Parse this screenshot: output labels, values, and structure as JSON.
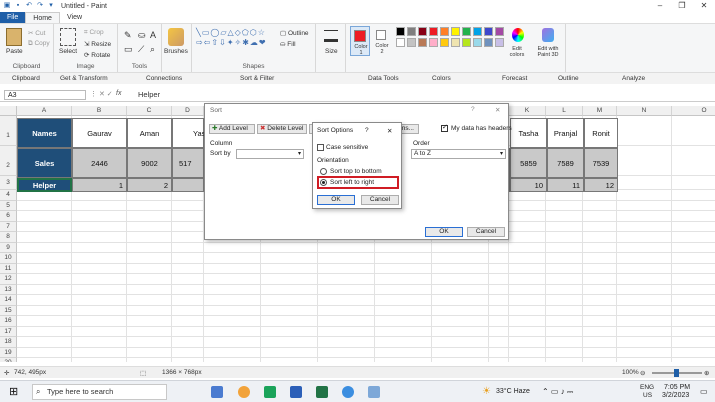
{
  "window": {
    "title": "Untitled - Paint"
  },
  "tabs": [
    "File",
    "Home",
    "View"
  ],
  "ribbon": {
    "clipboard": {
      "paste": "Paste",
      "cut": "Cut",
      "copy": "Copy",
      "label": "Clipboard"
    },
    "image": {
      "crop": "Crop",
      "resize": "Resize",
      "rotate": "Rotate",
      "select": "Select",
      "label": "Image"
    },
    "tools": {
      "label": "Tools"
    },
    "brushes": {
      "label": "Brushes"
    },
    "shapes": {
      "outline": "Outline",
      "fill": "Fill",
      "label": "Shapes"
    },
    "size": {
      "label": "Size"
    },
    "colors": {
      "color1": "Color 1",
      "color2": "Color 2",
      "edit": "Edit colors",
      "paint3d": "Edit with Paint 3D",
      "label": "Colors"
    },
    "excel_groups": [
      "Get & Transform",
      "Connections",
      "Sort & Filter",
      "Data Tools",
      "Forecast",
      "Outline",
      "Analyze"
    ],
    "palette": [
      "#000000",
      "#7f7f7f",
      "#880015",
      "#ed1c24",
      "#ff7f27",
      "#fff200",
      "#22b14c",
      "#00a2e8",
      "#3f48cc",
      "#a349a4",
      "#ffffff",
      "#c3c3c3",
      "#b97a57",
      "#ffaec9",
      "#ffc90e",
      "#efe4b0",
      "#b5e61d",
      "#99d9ea",
      "#7092be",
      "#c8bfe7"
    ]
  },
  "formula": {
    "namebox": "A3",
    "fx": "fx",
    "value": "Helper"
  },
  "columns": [
    "A",
    "B",
    "C",
    "D",
    "E",
    "F",
    "G",
    "H",
    "I",
    "J",
    "K",
    "L",
    "M",
    "N",
    "O"
  ],
  "rows": [
    "1",
    "2",
    "3",
    "4",
    "5",
    "6",
    "7",
    "8",
    "9",
    "10",
    "11",
    "12",
    "13",
    "14",
    "15",
    "16",
    "17",
    "18",
    "19",
    "20",
    "21",
    "22"
  ],
  "table": {
    "names_label": "Names",
    "sales_label": "Sales",
    "helper_label": "Helper",
    "left_names": [
      "Gaurav",
      "Aman",
      "Yash"
    ],
    "left_sales": [
      "2446",
      "9002",
      "517"
    ],
    "left_helper": [
      "1",
      "2"
    ],
    "right_names": [
      "Tasha",
      "Pranjal",
      "Ronit"
    ],
    "right_sales": [
      "5859",
      "7589",
      "7539"
    ],
    "right_helper": [
      "10",
      "11",
      "12"
    ]
  },
  "sort_dialog": {
    "title": "Sort",
    "help": "?",
    "close": "✕",
    "add_level": "Add Level",
    "delete_level": "Delete Level",
    "options": "Options...",
    "my_data_headers": "My data has headers",
    "column_label": "Column",
    "sort_by": "Sort by",
    "order_label": "Order",
    "order_value": "A to Z",
    "ok": "OK",
    "cancel": "Cancel"
  },
  "options_dialog": {
    "title": "Sort Options",
    "help": "?",
    "close": "✕",
    "case_sensitive": "Case sensitive",
    "orientation": "Orientation",
    "top_to_bottom": "Sort top to bottom",
    "left_to_right": "Sort left to right",
    "ok": "OK",
    "cancel": "Cancel"
  },
  "status": {
    "coords": "742, 495px",
    "dims": "1366 × 768px",
    "zoom": "100%"
  },
  "taskbar": {
    "search_placeholder": "Type here to search",
    "weather": "33°C Haze",
    "lang": "ENG",
    "region": "US",
    "time": "7:05 PM",
    "date": "3/2/2023"
  }
}
